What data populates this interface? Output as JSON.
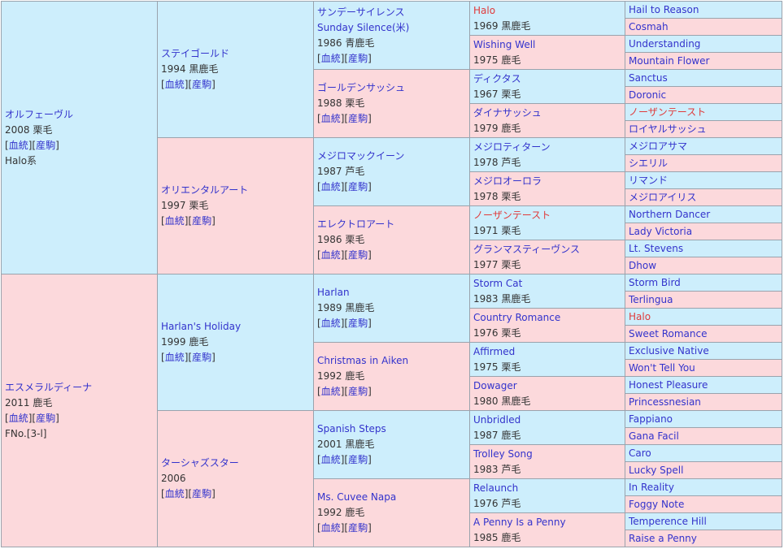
{
  "links": {
    "pedigree": "血統",
    "offspring": "産駒"
  },
  "gen1": [
    {
      "name": "オルフェーヴル",
      "year": "2008",
      "color": "栗毛",
      "extra": "Halo系",
      "sex": "m"
    },
    {
      "name": "エスメラルディーナ",
      "year": "2011",
      "color": "鹿毛",
      "extra": "FNo.[3-l]",
      "sex": "f"
    }
  ],
  "gen2": [
    {
      "name": "ステイゴールド",
      "year": "1994",
      "color": "黒鹿毛",
      "sex": "m"
    },
    {
      "name": "オリエンタルアート",
      "year": "1997",
      "color": "栗毛",
      "sex": "f"
    },
    {
      "name": "Harlan's Holiday",
      "year": "1999",
      "color": "鹿毛",
      "sex": "m"
    },
    {
      "name": "ターシャズスター",
      "year": "2006",
      "color": "",
      "sex": "f"
    }
  ],
  "gen3": [
    {
      "name": "サンデーサイレンス",
      "name2": "Sunday Silence(米)",
      "year": "1986",
      "color": "青鹿毛",
      "sex": "m"
    },
    {
      "name": "ゴールデンサッシュ",
      "year": "1988",
      "color": "栗毛",
      "sex": "f"
    },
    {
      "name": "メジロマックイーン",
      "year": "1987",
      "color": "芦毛",
      "sex": "m"
    },
    {
      "name": "エレクトロアート",
      "year": "1986",
      "color": "栗毛",
      "sex": "f"
    },
    {
      "name": "Harlan",
      "year": "1989",
      "color": "黒鹿毛",
      "sex": "m"
    },
    {
      "name": "Christmas in Aiken",
      "year": "1992",
      "color": "鹿毛",
      "sex": "f"
    },
    {
      "name": "Spanish Steps",
      "year": "2001",
      "color": "黒鹿毛",
      "sex": "m"
    },
    {
      "name": "Ms. Cuvee Napa",
      "year": "1992",
      "color": "鹿毛",
      "sex": "f"
    }
  ],
  "gen4": [
    {
      "name": "Halo",
      "year": "1969",
      "color": "黒鹿毛",
      "sex": "m",
      "red": true
    },
    {
      "name": "Wishing Well",
      "year": "1975",
      "color": "鹿毛",
      "sex": "f"
    },
    {
      "name": "ディクタス",
      "year": "1967",
      "color": "栗毛",
      "sex": "m"
    },
    {
      "name": "ダイナサッシュ",
      "year": "1979",
      "color": "鹿毛",
      "sex": "f"
    },
    {
      "name": "メジロティターン",
      "year": "1978",
      "color": "芦毛",
      "sex": "m"
    },
    {
      "name": "メジロオーロラ",
      "year": "1978",
      "color": "栗毛",
      "sex": "f"
    },
    {
      "name": "ノーザンテースト",
      "year": "1971",
      "color": "栗毛",
      "sex": "m",
      "red": true
    },
    {
      "name": "グランマスティーヴンス",
      "year": "1977",
      "color": "栗毛",
      "sex": "f"
    },
    {
      "name": "Storm Cat",
      "year": "1983",
      "color": "黒鹿毛",
      "sex": "m"
    },
    {
      "name": "Country Romance",
      "year": "1976",
      "color": "栗毛",
      "sex": "f"
    },
    {
      "name": "Affirmed",
      "year": "1975",
      "color": "栗毛",
      "sex": "m"
    },
    {
      "name": "Dowager",
      "year": "1980",
      "color": "黒鹿毛",
      "sex": "f"
    },
    {
      "name": "Unbridled",
      "year": "1987",
      "color": "鹿毛",
      "sex": "m"
    },
    {
      "name": "Trolley Song",
      "year": "1983",
      "color": "芦毛",
      "sex": "f"
    },
    {
      "name": "Relaunch",
      "year": "1976",
      "color": "芦毛",
      "sex": "m"
    },
    {
      "name": "A Penny Is a Penny",
      "year": "1985",
      "color": "鹿毛",
      "sex": "f"
    }
  ],
  "gen5": [
    {
      "name": "Hail to Reason",
      "sex": "m"
    },
    {
      "name": "Cosmah",
      "sex": "f"
    },
    {
      "name": "Understanding",
      "sex": "m"
    },
    {
      "name": "Mountain Flower",
      "sex": "f"
    },
    {
      "name": "Sanctus",
      "sex": "m"
    },
    {
      "name": "Doronic",
      "sex": "f"
    },
    {
      "name": "ノーザンテースト",
      "sex": "m",
      "red": true
    },
    {
      "name": "ロイヤルサッシュ",
      "sex": "f"
    },
    {
      "name": "メジロアサマ",
      "sex": "m"
    },
    {
      "name": "シエリル",
      "sex": "f"
    },
    {
      "name": "リマンド",
      "sex": "m"
    },
    {
      "name": "メジロアイリス",
      "sex": "f"
    },
    {
      "name": "Northern Dancer",
      "sex": "m"
    },
    {
      "name": "Lady Victoria",
      "sex": "f"
    },
    {
      "name": "Lt. Stevens",
      "sex": "m"
    },
    {
      "name": "Dhow",
      "sex": "f"
    },
    {
      "name": "Storm Bird",
      "sex": "m"
    },
    {
      "name": "Terlingua",
      "sex": "f"
    },
    {
      "name": "Halo",
      "sex": "m",
      "red": true
    },
    {
      "name": "Sweet Romance",
      "sex": "f"
    },
    {
      "name": "Exclusive Native",
      "sex": "m"
    },
    {
      "name": "Won't Tell You",
      "sex": "f"
    },
    {
      "name": "Honest Pleasure",
      "sex": "m"
    },
    {
      "name": "Princessnesian",
      "sex": "f"
    },
    {
      "name": "Fappiano",
      "sex": "m"
    },
    {
      "name": "Gana Facil",
      "sex": "f"
    },
    {
      "name": "Caro",
      "sex": "m"
    },
    {
      "name": "Lucky Spell",
      "sex": "f"
    },
    {
      "name": "In Reality",
      "sex": "m"
    },
    {
      "name": "Foggy Note",
      "sex": "f"
    },
    {
      "name": "Temperence Hill",
      "sex": "m"
    },
    {
      "name": "Raise a Penny",
      "sex": "f"
    }
  ]
}
